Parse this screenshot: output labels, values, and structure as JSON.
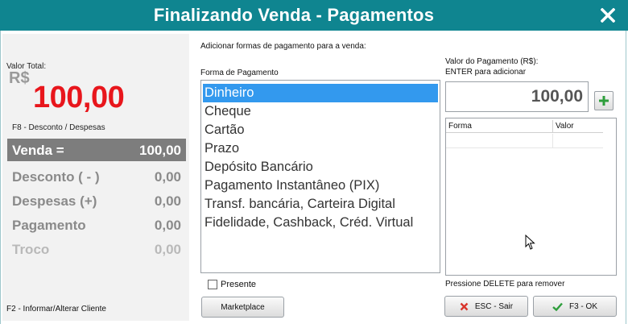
{
  "window": {
    "title": "Finalizando Venda - Pagamentos",
    "close_label": "X",
    "accent_color": "#0f8590"
  },
  "summary": {
    "total_label": "Valor Total:",
    "currency": "R$",
    "total_value": "100,00",
    "f8_hint": "F8 - Desconto / Despesas",
    "venda": {
      "label": "Venda =",
      "value": "100,00"
    },
    "rows": [
      {
        "label": "Desconto ( - )",
        "value": "0,00"
      },
      {
        "label": "Despesas (+)",
        "value": "0,00"
      },
      {
        "label": "Pagamento",
        "value": "0,00"
      },
      {
        "label": "Troco",
        "value": "0,00"
      }
    ],
    "f2_hint": "F2 - Informar/Alterar Cliente"
  },
  "payment": {
    "header": "Adicionar formas de pagamento para a venda:",
    "list_label": "Forma de Pagamento",
    "methods": [
      "Dinheiro",
      "Cheque",
      "Cartão",
      "Prazo",
      "Depósito Bancário",
      "Pagamento Instantâneo (PIX)",
      "Transf. bancária, Carteira Digital",
      "Fidelidade, Cashback, Créd. Virtual"
    ],
    "selected_index": 0,
    "presente_label": "Presente",
    "marketplace_label": "Marketplace"
  },
  "amount": {
    "label_line1": "Valor do Pagamento (R$):",
    "label_line2": "ENTER para adicionar",
    "value": "100,00",
    "add_icon": "plus-icon",
    "grid_columns": [
      "Forma",
      "Valor"
    ],
    "delete_hint": "Pressione DELETE para remover"
  },
  "actions": {
    "esc_label": "ESC - Sair",
    "ok_label": "F3 - OK",
    "esc_icon": "x-icon",
    "ok_icon": "check-icon",
    "danger_color": "#d9342b",
    "success_color": "#2e9e3c"
  }
}
